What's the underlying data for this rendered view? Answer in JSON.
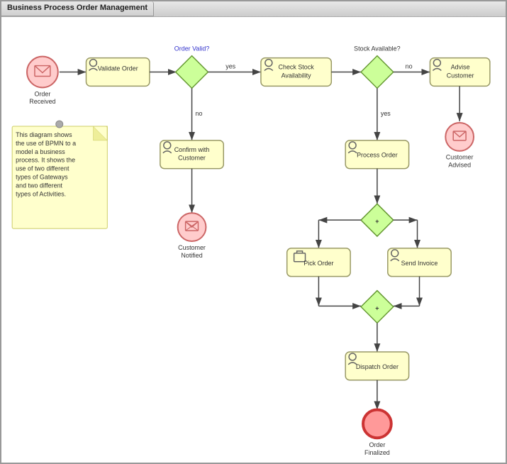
{
  "window": {
    "title": "Business Process Order Management"
  },
  "nodes": {
    "order_received": {
      "label": "Order\nReceived"
    },
    "validate_order": {
      "label": "Validate Order"
    },
    "order_valid_gateway": {
      "label": "Order Valid?"
    },
    "check_stock": {
      "label": "Check Stock\nAvailability"
    },
    "stock_available_gateway": {
      "label": "Stock Available?"
    },
    "advise_customer": {
      "label": "Advise\nCustomer"
    },
    "customer_advised": {
      "label": "Customer\nAdvised"
    },
    "confirm_customer": {
      "label": "Confirm with\nCustomer"
    },
    "customer_notified": {
      "label": "Customer\nNotified"
    },
    "process_order": {
      "label": "Process Order"
    },
    "parallel_gateway1": {
      "label": "+"
    },
    "pick_order": {
      "label": "Pick Order"
    },
    "send_invoice": {
      "label": "Send Invoice"
    },
    "parallel_gateway2": {
      "label": "+"
    },
    "dispatch_order": {
      "label": "Dispatch Order"
    },
    "order_finalized": {
      "label": "Order\nFinalized"
    }
  },
  "note": {
    "text": "This diagram shows the use of BPMN to a model a business process. It shows the use of two different types of Gateways and two different types of Activities."
  },
  "labels": {
    "yes1": "yes",
    "no1": "no",
    "yes2": "yes",
    "no2": "no"
  }
}
